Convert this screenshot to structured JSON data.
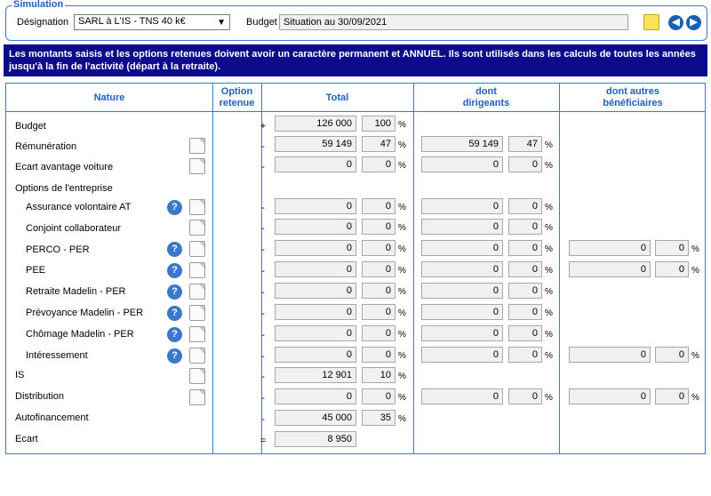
{
  "simulation": {
    "legend": "Simulation",
    "designation_label": "Désignation",
    "designation_value": "SARL à L'IS - TNS 40 k€",
    "budget_label": "Budget",
    "budget_value": "Situation au 30/09/2021"
  },
  "banner": "Les montants saisis et les options retenues doivent avoir un caractère permanent et ANNUEL. Ils sont utilisés dans les calculs de toutes les années jusqu'à la fin de l'activité (départ à la retraite).",
  "columns": {
    "nature": "Nature",
    "option_line1": "Option",
    "option_line2": "retenue",
    "total": "Total",
    "dirigeants_line1": "dont",
    "dirigeants_line2": "dirigeants",
    "autres_line1": "dont autres",
    "autres_line2": "bénéficiaires"
  },
  "pct_symbol": "%",
  "rows": {
    "budget": {
      "label": "Budget",
      "sign": "+",
      "total": "126 000",
      "total_pct": "100"
    },
    "remuneration": {
      "label": "Rémunération",
      "sign": "-",
      "total": "59 149",
      "total_pct": "47",
      "dir": "59 149",
      "dir_pct": "47"
    },
    "ecart_voiture": {
      "label": "Ecart avantage voiture",
      "sign": "-",
      "total": "0",
      "total_pct": "0",
      "dir": "0",
      "dir_pct": "0"
    },
    "options_header": {
      "label": "Options de l'entreprise"
    },
    "assurance": {
      "label": "Assurance volontaire AT",
      "sign": "-",
      "total": "0",
      "total_pct": "0",
      "dir": "0",
      "dir_pct": "0"
    },
    "conjoint": {
      "label": "Conjoint collaborateur",
      "sign": "-",
      "total": "0",
      "total_pct": "0",
      "dir": "0",
      "dir_pct": "0"
    },
    "perco": {
      "label": "PERCO - PER",
      "sign": "-",
      "total": "0",
      "total_pct": "0",
      "dir": "0",
      "dir_pct": "0",
      "aut": "0",
      "aut_pct": "0"
    },
    "pee": {
      "label": "PEE",
      "sign": "-",
      "total": "0",
      "total_pct": "0",
      "dir": "0",
      "dir_pct": "0",
      "aut": "0",
      "aut_pct": "0"
    },
    "retraite": {
      "label": "Retraite Madelin - PER",
      "sign": "-",
      "total": "0",
      "total_pct": "0",
      "dir": "0",
      "dir_pct": "0"
    },
    "prevoyance": {
      "label": "Prévoyance Madelin - PER",
      "sign": "-",
      "total": "0",
      "total_pct": "0",
      "dir": "0",
      "dir_pct": "0"
    },
    "chomage": {
      "label": "Chômage Madelin - PER",
      "sign": "-",
      "total": "0",
      "total_pct": "0",
      "dir": "0",
      "dir_pct": "0"
    },
    "interessement": {
      "label": "Intéressement",
      "sign": "-",
      "total": "0",
      "total_pct": "0",
      "dir": "0",
      "dir_pct": "0",
      "aut": "0",
      "aut_pct": "0"
    },
    "is": {
      "label": "IS",
      "sign": "-",
      "total": "12 901",
      "total_pct": "10"
    },
    "distribution": {
      "label": "Distribution",
      "sign": "-",
      "total": "0",
      "total_pct": "0",
      "dir": "0",
      "dir_pct": "0",
      "aut": "0",
      "aut_pct": "0"
    },
    "autofinancement": {
      "label": "Autofinancement",
      "sign": "-",
      "total": "45 000",
      "total_pct": "35"
    },
    "ecart": {
      "label": "Ecart",
      "sign": "=",
      "total": "8 950"
    }
  },
  "icons": {
    "help": "?",
    "prev": "◀",
    "next": "▶",
    "dropdown": "▼"
  }
}
